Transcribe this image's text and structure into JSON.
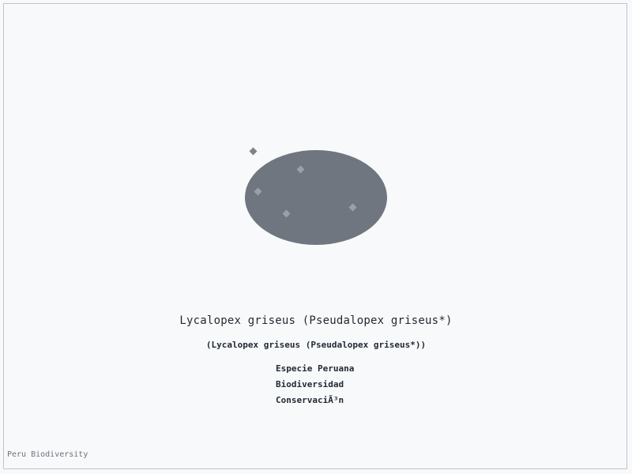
{
  "species": {
    "title": "Lycalopex griseus (Pseudalopex griseus*)",
    "subtitle": "(Lycalopex griseus (Pseudalopex griseus*))"
  },
  "tags": [
    "Especie Peruana",
    "Biodiversidad",
    "ConservaciÃ³n"
  ],
  "footer": {
    "label": "Peru Biodiversity"
  },
  "colors": {
    "background": "#f8f9fa",
    "shape": "#6f7680",
    "dots": "#9aa0a8",
    "text": "#1f2933"
  }
}
